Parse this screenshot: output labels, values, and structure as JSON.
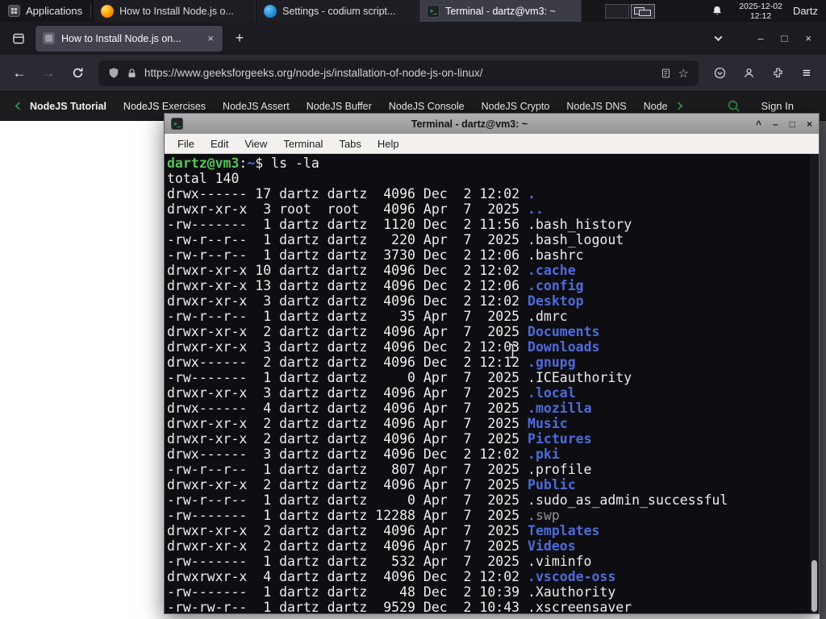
{
  "colors": {
    "panel-bg": "#15151a",
    "tabbar-bg": "#1c1b22",
    "toolbar-bg": "#2b2a33",
    "urlbar-bg": "#1d1b22",
    "gfg-bg": "#1c1c1f",
    "gfg-green": "#2f8d46",
    "term-bg": "#0e0e12",
    "term-fg": "#ededee",
    "term-green": "#54c454",
    "term-blue": "#4d6bdb",
    "term-dim": "#909095"
  },
  "glyphs": {
    "back": "←",
    "forward": "→",
    "new_tab": "+",
    "close_tab": "×",
    "window_minimize": "–",
    "window_maximize": "□",
    "window_close": "×",
    "term_rollup": "^",
    "term_minimize": "–",
    "term_maximize": "□",
    "term_close": "×",
    "star": "☆",
    "app_menu": "≡",
    "terminal_glyph": ">_"
  },
  "panel": {
    "applications_label": "Applications",
    "taskbar": [
      {
        "title": "How to Install Node.js o...",
        "icon": "firefox",
        "active": false
      },
      {
        "title": "Settings - codium script...",
        "icon": "codium",
        "active": false
      },
      {
        "title": "Terminal - dartz@vm3: ~",
        "icon": "terminal",
        "active": true
      }
    ],
    "clock_date": "2025-12-02",
    "clock_time": "12:12",
    "user": "Dartz"
  },
  "browser": {
    "active_tab_title": "How to Install Node.js on...",
    "url": "https://www.geeksforgeeks.org/node-js/installation-of-node-js-on-linux/"
  },
  "gfg": {
    "links": [
      "NodeJS Tutorial",
      "NodeJS Exercises",
      "NodeJS Assert",
      "NodeJS Buffer",
      "NodeJS Console",
      "NodeJS Crypto",
      "NodeJS DNS",
      "Node"
    ],
    "sign_in": "Sign In"
  },
  "terminal": {
    "title": "Terminal - dartz@vm3: ~",
    "menu": [
      "File",
      "Edit",
      "View",
      "Terminal",
      "Tabs",
      "Help"
    ],
    "lines": [
      [
        {
          "c": "green",
          "t": "dartz@vm3"
        },
        {
          "c": "fg",
          "t": ":"
        },
        {
          "c": "blue",
          "t": "~"
        },
        {
          "c": "fg",
          "t": "$ ls -la"
        }
      ],
      [
        {
          "c": "fg",
          "t": "total 140"
        }
      ],
      [
        {
          "c": "fg",
          "t": "drwx------ 17 dartz dartz  4096 Dec  2 12:02 "
        },
        {
          "c": "blue",
          "t": "."
        }
      ],
      [
        {
          "c": "fg",
          "t": "drwxr-xr-x  3 root  root   4096 Apr  7  2025 "
        },
        {
          "c": "blue",
          "t": ".."
        }
      ],
      [
        {
          "c": "fg",
          "t": "-rw-------  1 dartz dartz  1120 Dec  2 11:56 .bash_history"
        }
      ],
      [
        {
          "c": "fg",
          "t": "-rw-r--r--  1 dartz dartz   220 Apr  7  2025 .bash_logout"
        }
      ],
      [
        {
          "c": "fg",
          "t": "-rw-r--r--  1 dartz dartz  3730 Dec  2 12:06 .bashrc"
        }
      ],
      [
        {
          "c": "fg",
          "t": "drwxr-xr-x 10 dartz dartz  4096 Dec  2 12:02 "
        },
        {
          "c": "blue",
          "t": ".cache"
        }
      ],
      [
        {
          "c": "fg",
          "t": "drwxr-xr-x 13 dartz dartz  4096 Dec  2 12:06 "
        },
        {
          "c": "blue",
          "t": ".config"
        }
      ],
      [
        {
          "c": "fg",
          "t": "drwxr-xr-x  3 dartz dartz  4096 Dec  2 12:02 "
        },
        {
          "c": "blue",
          "t": "Desktop"
        }
      ],
      [
        {
          "c": "fg",
          "t": "-rw-r--r--  1 dartz dartz    35 Apr  7  2025 .dmrc"
        }
      ],
      [
        {
          "c": "fg",
          "t": "drwxr-xr-x  2 dartz dartz  4096 Apr  7  2025 "
        },
        {
          "c": "blue",
          "t": "Documents"
        }
      ],
      [
        {
          "c": "fg",
          "t": "drwxr-xr-x  3 dartz dartz  4096 Dec  2 12:03 "
        },
        {
          "c": "blue",
          "t": "Downloads"
        }
      ],
      [
        {
          "c": "fg",
          "t": "drwx------  2 dartz dartz  4096 Dec  2 12:12 "
        },
        {
          "c": "blue",
          "t": ".gnupg"
        }
      ],
      [
        {
          "c": "fg",
          "t": "-rw-------  1 dartz dartz     0 Apr  7  2025 .ICEauthority"
        }
      ],
      [
        {
          "c": "fg",
          "t": "drwxr-xr-x  3 dartz dartz  4096 Apr  7  2025 "
        },
        {
          "c": "blue",
          "t": ".local"
        }
      ],
      [
        {
          "c": "fg",
          "t": "drwx------  4 dartz dartz  4096 Apr  7  2025 "
        },
        {
          "c": "blue",
          "t": ".mozilla"
        }
      ],
      [
        {
          "c": "fg",
          "t": "drwxr-xr-x  2 dartz dartz  4096 Apr  7  2025 "
        },
        {
          "c": "blue",
          "t": "Music"
        }
      ],
      [
        {
          "c": "fg",
          "t": "drwxr-xr-x  2 dartz dartz  4096 Apr  7  2025 "
        },
        {
          "c": "blue",
          "t": "Pictures"
        }
      ],
      [
        {
          "c": "fg",
          "t": "drwx------  3 dartz dartz  4096 Dec  2 12:02 "
        },
        {
          "c": "blue",
          "t": ".pki"
        }
      ],
      [
        {
          "c": "fg",
          "t": "-rw-r--r--  1 dartz dartz   807 Apr  7  2025 .profile"
        }
      ],
      [
        {
          "c": "fg",
          "t": "drwxr-xr-x  2 dartz dartz  4096 Apr  7  2025 "
        },
        {
          "c": "blue",
          "t": "Public"
        }
      ],
      [
        {
          "c": "fg",
          "t": "-rw-r--r--  1 dartz dartz     0 Apr  7  2025 .sudo_as_admin_successful"
        }
      ],
      [
        {
          "c": "fg",
          "t": "-rw-------  1 dartz dartz 12288 Apr  7  2025 "
        },
        {
          "c": "dim",
          "t": ".swp"
        }
      ],
      [
        {
          "c": "fg",
          "t": "drwxr-xr-x  2 dartz dartz  4096 Apr  7  2025 "
        },
        {
          "c": "blue",
          "t": "Templates"
        }
      ],
      [
        {
          "c": "fg",
          "t": "drwxr-xr-x  2 dartz dartz  4096 Apr  7  2025 "
        },
        {
          "c": "blue",
          "t": "Videos"
        }
      ],
      [
        {
          "c": "fg",
          "t": "-rw-------  1 dartz dartz   532 Apr  7  2025 .viminfo"
        }
      ],
      [
        {
          "c": "fg",
          "t": "drwxrwxr-x  4 dartz dartz  4096 Dec  2 12:02 "
        },
        {
          "c": "blue",
          "t": ".vscode-oss"
        }
      ],
      [
        {
          "c": "fg",
          "t": "-rw-------  1 dartz dartz    48 Dec  2 10:39 .Xauthority"
        }
      ],
      [
        {
          "c": "fg",
          "t": "-rw-rw-r--  1 dartz dartz  9529 Dec  2 10:43 .xscreensaver"
        }
      ]
    ]
  }
}
